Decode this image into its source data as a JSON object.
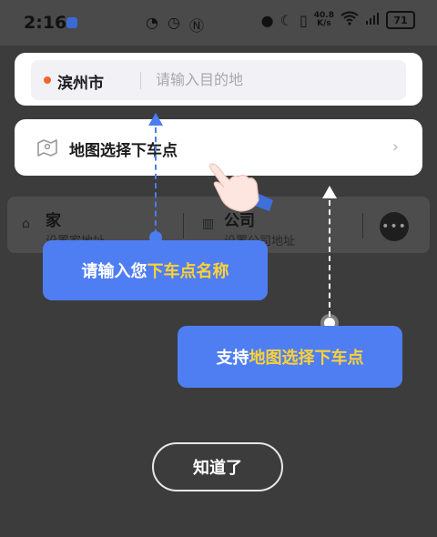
{
  "status_bar": {
    "time": "2:16",
    "net_speed_value": "40.8",
    "net_speed_unit": "K/s",
    "battery": "71"
  },
  "search": {
    "city": "滨州市",
    "destination_placeholder": "请输入目的地"
  },
  "map_select": {
    "label": "地图选择下车点",
    "chevron": "›"
  },
  "background": {
    "home_label": "家",
    "home_sub": "设置家地址",
    "company_label": "公司",
    "company_sub": "设置公司地址",
    "more": "•••"
  },
  "tips": {
    "tip1_prefix": "请输入您",
    "tip1_highlight": "下车点名称",
    "tip2_prefix": "支持",
    "tip2_highlight": "地图选择下车点"
  },
  "confirm_label": "知道了",
  "colors": {
    "accent_blue": "#4f7ef2",
    "highlight_yellow": "#ffd234",
    "city_dot": "#f2642c"
  }
}
